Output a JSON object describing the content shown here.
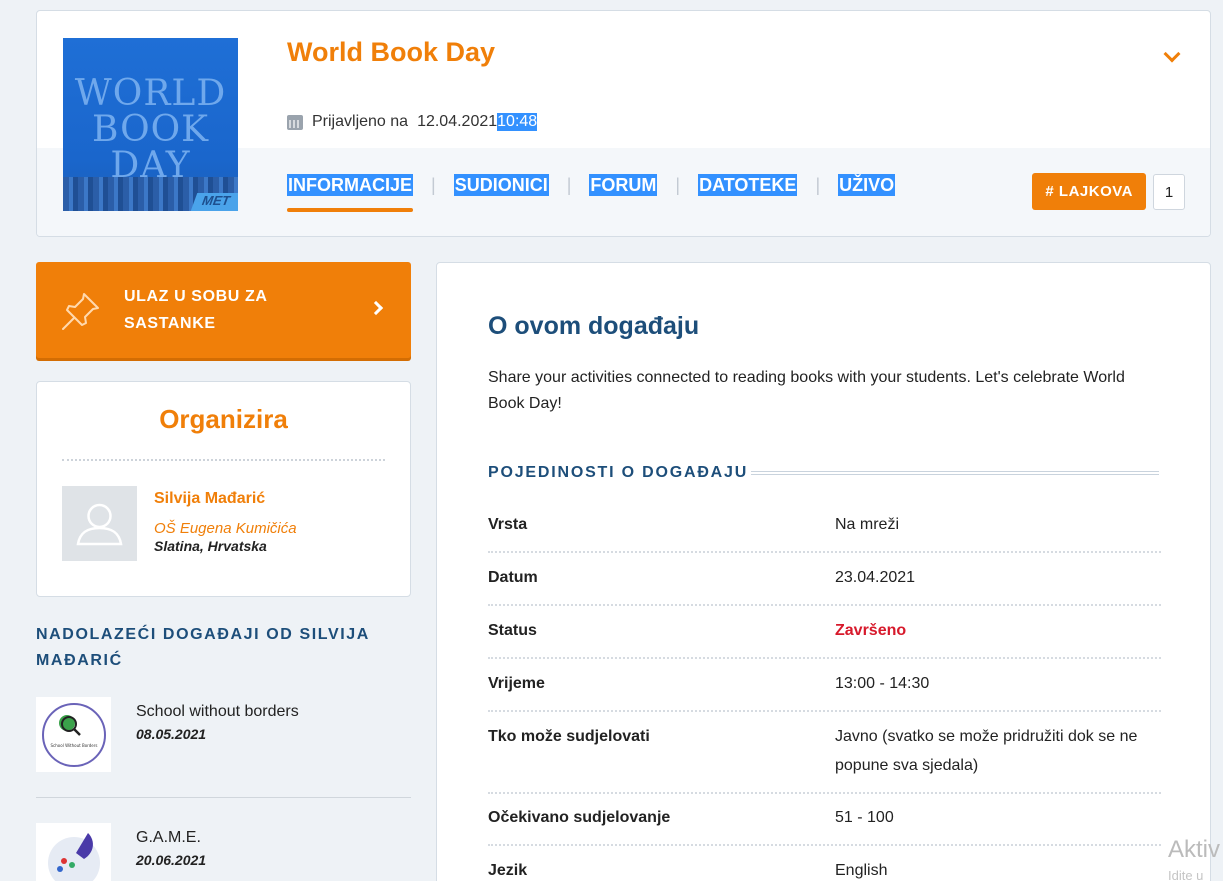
{
  "header": {
    "title": "World Book Day",
    "cover_text_line1": "WORLD",
    "cover_text_line2": "BOOK DAY",
    "cover_corner": "MET",
    "registered_label": "Prijavljeno na",
    "registered_date": "12.04.2021",
    "registered_time": "10:48",
    "tabs": [
      "INFORMACIJE",
      "SUDIONICI",
      "FORUM",
      "DATOTEKE",
      "UŽIVO"
    ],
    "active_tab": "INFORMACIJE",
    "likes_label": "# LAJKOVA",
    "likes_count": "1"
  },
  "sidebar": {
    "meeting_button": "ULAZ U SOBU ZA SASTANKE",
    "organizer": {
      "heading": "Organizira",
      "name": "Silvija Mađarić",
      "school": "OŠ Eugena Kumičića",
      "location": "Slatina, Hrvatska"
    },
    "upcoming_heading": "NADOLAZEĆI DOGAĐAJI OD SILVIJA MAĐARIĆ",
    "upcoming": [
      {
        "title": "School without borders",
        "date": "08.05.2021",
        "thumb_text": "School Without Borders"
      },
      {
        "title": "G.A.M.E.",
        "date": "20.06.2021"
      }
    ]
  },
  "main": {
    "about_title": "O ovom događaju",
    "about_text": "Share your activities connected to reading books with your students. Let's celebrate World Book Day!",
    "details_title": "POJEDINOSTI O DOGAĐAJU",
    "details": [
      {
        "key": "Vrsta",
        "value": "Na mreži"
      },
      {
        "key": "Datum",
        "value": "23.04.2021"
      },
      {
        "key": "Status",
        "value": "Završeno"
      },
      {
        "key": "Vrijeme",
        "value": "13:00 - 14:30"
      },
      {
        "key": "Tko može sudjelovati",
        "value": "Javno (svatko se može pridružiti dok se ne popune sva sjedala)"
      },
      {
        "key": "Očekivano sudjelovanje",
        "value": "51 - 100"
      },
      {
        "key": "Jezik",
        "value": "English"
      }
    ]
  },
  "overlay": {
    "activate_text": "Aktiv",
    "activate_sub": "Idite u"
  },
  "colors": {
    "accent": "#f07f09",
    "heading_blue": "#1d4e7a",
    "status_red": "#d7192b",
    "selection": "#3391ff"
  }
}
